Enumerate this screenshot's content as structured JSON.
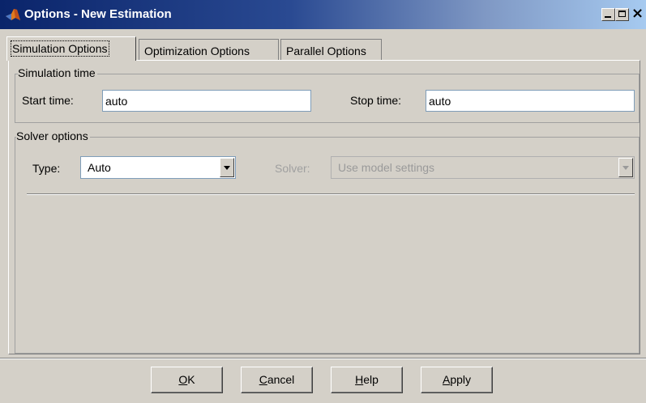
{
  "window": {
    "title": "Options - New Estimation",
    "icon": "matlab-icon",
    "controls": {
      "minimize": "minimize-icon",
      "maximize": "maximize-icon",
      "close": "×"
    }
  },
  "tabs": [
    {
      "label": "Simulation Options",
      "active": true
    },
    {
      "label": "Optimization Options",
      "active": false
    },
    {
      "label": "Parallel Options",
      "active": false
    }
  ],
  "simulation_time": {
    "legend": "Simulation time",
    "start_label": "Start time:",
    "start_value": "auto",
    "stop_label": "Stop time:",
    "stop_value": "auto"
  },
  "solver_options": {
    "legend": "Solver options",
    "type_label": "Type:",
    "type_value": "Auto",
    "solver_label": "Solver:",
    "solver_value": "Use model settings",
    "solver_enabled": false
  },
  "buttons": [
    {
      "first": "O",
      "rest": "K"
    },
    {
      "first": "C",
      "rest": "ancel"
    },
    {
      "first": "H",
      "rest": "elp"
    },
    {
      "first": "A",
      "rest": "pply"
    }
  ]
}
